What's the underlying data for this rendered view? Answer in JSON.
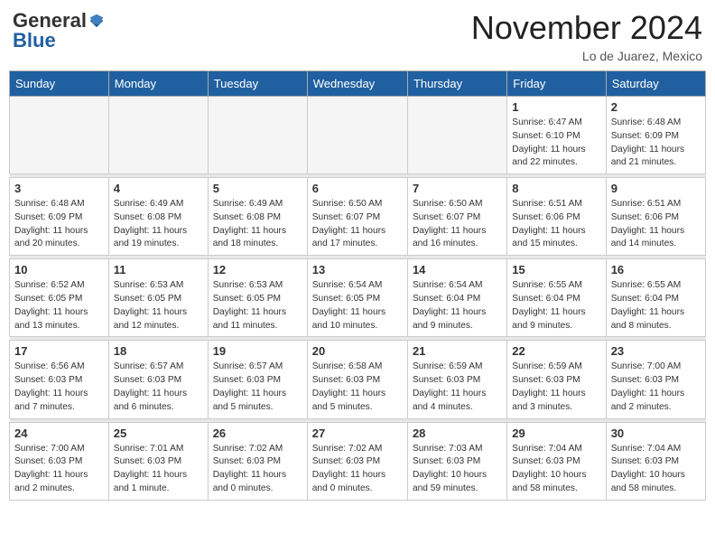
{
  "header": {
    "logo_general": "General",
    "logo_blue": "Blue",
    "title": "November 2024",
    "location": "Lo de Juarez, Mexico"
  },
  "calendar": {
    "weekdays": [
      "Sunday",
      "Monday",
      "Tuesday",
      "Wednesday",
      "Thursday",
      "Friday",
      "Saturday"
    ],
    "weeks": [
      [
        {
          "day": "",
          "info": ""
        },
        {
          "day": "",
          "info": ""
        },
        {
          "day": "",
          "info": ""
        },
        {
          "day": "",
          "info": ""
        },
        {
          "day": "",
          "info": ""
        },
        {
          "day": "1",
          "info": "Sunrise: 6:47 AM\nSunset: 6:10 PM\nDaylight: 11 hours and 22 minutes."
        },
        {
          "day": "2",
          "info": "Sunrise: 6:48 AM\nSunset: 6:09 PM\nDaylight: 11 hours and 21 minutes."
        }
      ],
      [
        {
          "day": "3",
          "info": "Sunrise: 6:48 AM\nSunset: 6:09 PM\nDaylight: 11 hours and 20 minutes."
        },
        {
          "day": "4",
          "info": "Sunrise: 6:49 AM\nSunset: 6:08 PM\nDaylight: 11 hours and 19 minutes."
        },
        {
          "day": "5",
          "info": "Sunrise: 6:49 AM\nSunset: 6:08 PM\nDaylight: 11 hours and 18 minutes."
        },
        {
          "day": "6",
          "info": "Sunrise: 6:50 AM\nSunset: 6:07 PM\nDaylight: 11 hours and 17 minutes."
        },
        {
          "day": "7",
          "info": "Sunrise: 6:50 AM\nSunset: 6:07 PM\nDaylight: 11 hours and 16 minutes."
        },
        {
          "day": "8",
          "info": "Sunrise: 6:51 AM\nSunset: 6:06 PM\nDaylight: 11 hours and 15 minutes."
        },
        {
          "day": "9",
          "info": "Sunrise: 6:51 AM\nSunset: 6:06 PM\nDaylight: 11 hours and 14 minutes."
        }
      ],
      [
        {
          "day": "10",
          "info": "Sunrise: 6:52 AM\nSunset: 6:05 PM\nDaylight: 11 hours and 13 minutes."
        },
        {
          "day": "11",
          "info": "Sunrise: 6:53 AM\nSunset: 6:05 PM\nDaylight: 11 hours and 12 minutes."
        },
        {
          "day": "12",
          "info": "Sunrise: 6:53 AM\nSunset: 6:05 PM\nDaylight: 11 hours and 11 minutes."
        },
        {
          "day": "13",
          "info": "Sunrise: 6:54 AM\nSunset: 6:05 PM\nDaylight: 11 hours and 10 minutes."
        },
        {
          "day": "14",
          "info": "Sunrise: 6:54 AM\nSunset: 6:04 PM\nDaylight: 11 hours and 9 minutes."
        },
        {
          "day": "15",
          "info": "Sunrise: 6:55 AM\nSunset: 6:04 PM\nDaylight: 11 hours and 9 minutes."
        },
        {
          "day": "16",
          "info": "Sunrise: 6:55 AM\nSunset: 6:04 PM\nDaylight: 11 hours and 8 minutes."
        }
      ],
      [
        {
          "day": "17",
          "info": "Sunrise: 6:56 AM\nSunset: 6:03 PM\nDaylight: 11 hours and 7 minutes."
        },
        {
          "day": "18",
          "info": "Sunrise: 6:57 AM\nSunset: 6:03 PM\nDaylight: 11 hours and 6 minutes."
        },
        {
          "day": "19",
          "info": "Sunrise: 6:57 AM\nSunset: 6:03 PM\nDaylight: 11 hours and 5 minutes."
        },
        {
          "day": "20",
          "info": "Sunrise: 6:58 AM\nSunset: 6:03 PM\nDaylight: 11 hours and 5 minutes."
        },
        {
          "day": "21",
          "info": "Sunrise: 6:59 AM\nSunset: 6:03 PM\nDaylight: 11 hours and 4 minutes."
        },
        {
          "day": "22",
          "info": "Sunrise: 6:59 AM\nSunset: 6:03 PM\nDaylight: 11 hours and 3 minutes."
        },
        {
          "day": "23",
          "info": "Sunrise: 7:00 AM\nSunset: 6:03 PM\nDaylight: 11 hours and 2 minutes."
        }
      ],
      [
        {
          "day": "24",
          "info": "Sunrise: 7:00 AM\nSunset: 6:03 PM\nDaylight: 11 hours and 2 minutes."
        },
        {
          "day": "25",
          "info": "Sunrise: 7:01 AM\nSunset: 6:03 PM\nDaylight: 11 hours and 1 minute."
        },
        {
          "day": "26",
          "info": "Sunrise: 7:02 AM\nSunset: 6:03 PM\nDaylight: 11 hours and 0 minutes."
        },
        {
          "day": "27",
          "info": "Sunrise: 7:02 AM\nSunset: 6:03 PM\nDaylight: 11 hours and 0 minutes."
        },
        {
          "day": "28",
          "info": "Sunrise: 7:03 AM\nSunset: 6:03 PM\nDaylight: 10 hours and 59 minutes."
        },
        {
          "day": "29",
          "info": "Sunrise: 7:04 AM\nSunset: 6:03 PM\nDaylight: 10 hours and 58 minutes."
        },
        {
          "day": "30",
          "info": "Sunrise: 7:04 AM\nSunset: 6:03 PM\nDaylight: 10 hours and 58 minutes."
        }
      ]
    ]
  }
}
